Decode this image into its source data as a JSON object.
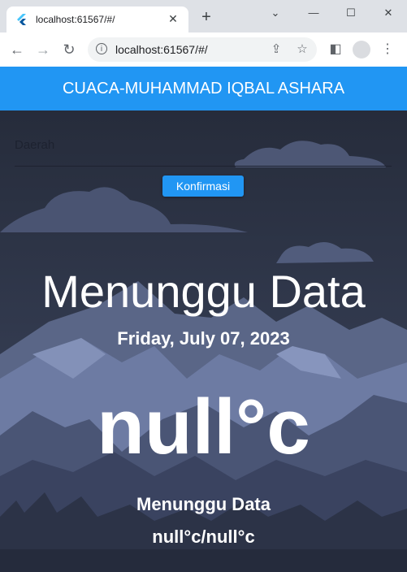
{
  "browser": {
    "tab_title": "localhost:61567/#/",
    "url": "localhost:61567/#/",
    "new_tab_symbol": "+",
    "close_symbol": "✕"
  },
  "app": {
    "title": "CUACA-MUHAMMAD IQBAL ASHARA",
    "accent": "#2196f3"
  },
  "form": {
    "field_label": "Daerah",
    "confirm_label": "Konfirmasi"
  },
  "weather": {
    "status": "Menunggu Data",
    "date": "Friday, July 07, 2023",
    "temperature": "null°c",
    "description": "Menunggu Data",
    "range": "null°c/null°c"
  }
}
